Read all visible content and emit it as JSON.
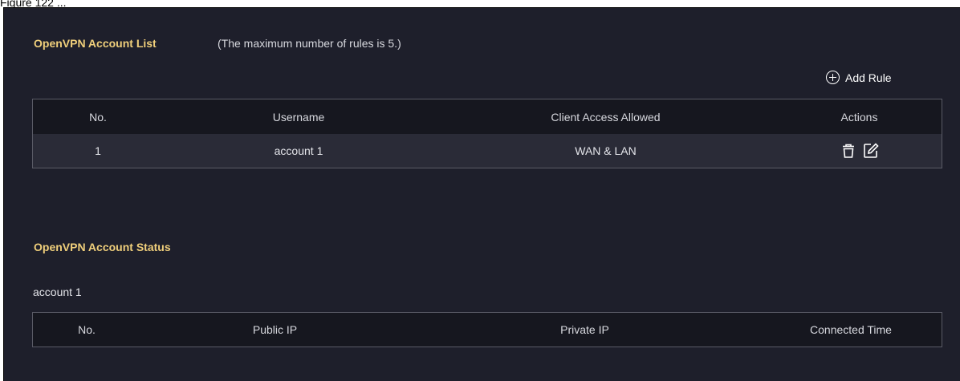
{
  "caption": "Figure 122 ...",
  "account_list": {
    "title": "OpenVPN Account List",
    "note": "(The maximum number of rules is 5.)",
    "add_rule_label": "Add Rule",
    "columns": [
      "No.",
      "Username",
      "Client Access Allowed",
      "Actions"
    ],
    "rows": [
      {
        "no": "1",
        "username": "account 1",
        "access": "WAN & LAN",
        "actions": [
          "delete-icon",
          "edit-icon"
        ]
      }
    ]
  },
  "account_status": {
    "title": "OpenVPN Account Status",
    "account_name": "account 1",
    "columns": [
      "No.",
      "Public IP",
      "Private IP",
      "Connected Time"
    ]
  },
  "colors": {
    "background": "#1e1f2b",
    "accent": "#f0cf7b",
    "header_row": "#16171f",
    "body_row": "#2a2b37"
  }
}
